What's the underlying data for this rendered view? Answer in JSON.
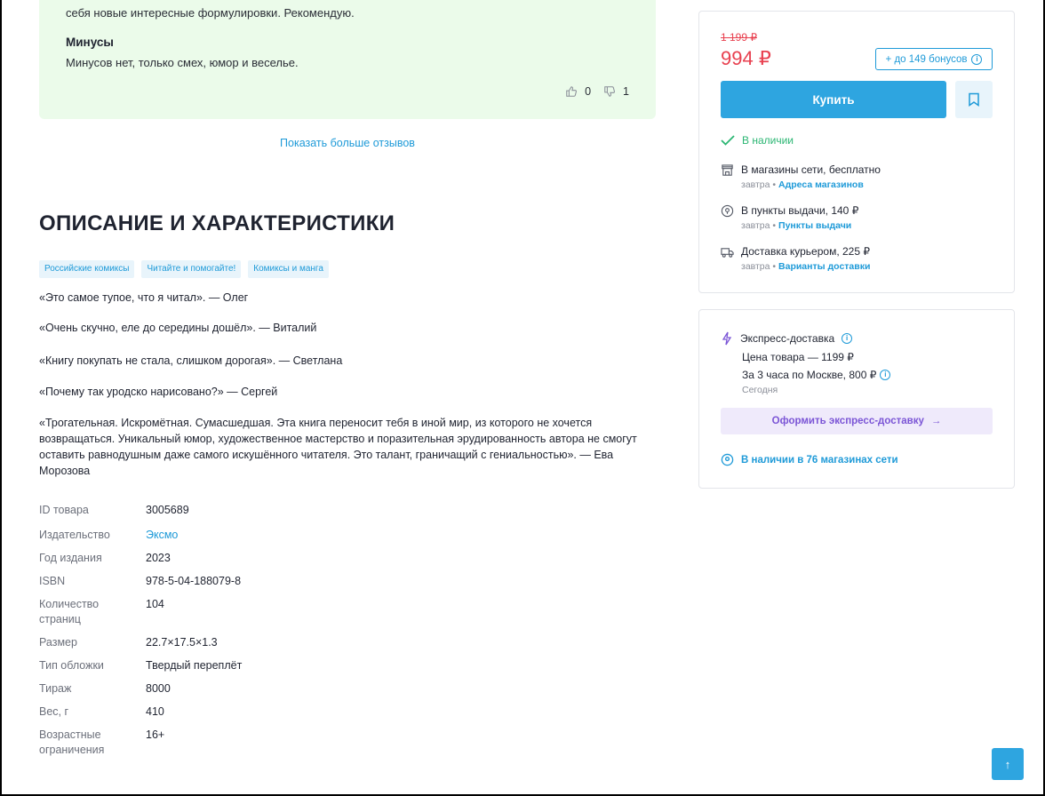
{
  "review": {
    "text_line": "себя новые интересные формулировки. Рекомендую.",
    "minus_heading": "Минусы",
    "minus_text": "Минусов нет, только смех, юмор и веселье.",
    "likes": "0",
    "dislikes": "1"
  },
  "show_more_reviews": "Показать больше отзывов",
  "section_title": "ОПИСАНИЕ И ХАРАКТЕРИСТИКИ",
  "tags": [
    "Российские комиксы",
    "Читайте и помогайте!",
    "Комиксы и манга"
  ],
  "description": [
    "«Это самое тупое, что я читал». — Олег",
    "«Очень скучно, еле до середины дошёл». — Виталий",
    "«Книгу покупать не стала, слишком дорогая». — Светлана",
    "«Почему так уродско нарисовано?» — Сергей",
    "«Трогательная. Искромётная. Сумасшедшая. Эта книга переносит тебя в иной мир, из которого не хочется возвращаться. Уникальный юмор, художественное мастерство и поразительная эрудированность автора не смогут оставить равнодушным даже самого искушённого читателя. Это талант, граничащий с гениальностью». — Ева Морозова"
  ],
  "specs": [
    {
      "key": "ID товара",
      "value": "3005689"
    },
    {
      "key": "Издательство",
      "value": "Эксмо"
    },
    {
      "key": "Год издания",
      "value": "2023"
    },
    {
      "key": "ISBN",
      "value": "978-5-04-188079-8"
    },
    {
      "key": "Количество страниц",
      "value": "104"
    },
    {
      "key": "Размер",
      "value": "22.7×17.5×1.3"
    },
    {
      "key": "Тип обложки",
      "value": "Твердый переплёт"
    },
    {
      "key": "Тираж",
      "value": "8000"
    },
    {
      "key": "Вес, г",
      "value": "410"
    },
    {
      "key": "Возрастные ограничения",
      "value": "16+"
    }
  ],
  "buy": {
    "old_price": "1 199 ₽",
    "price": "994 ₽",
    "bonus": "+ до 149 бонусов",
    "buy_label": "Купить",
    "in_stock": "В наличии",
    "delivery": [
      {
        "title": "В магазины сети, бесплатно",
        "when": "завтра",
        "link": "Адреса магазинов",
        "icon": "store-icon"
      },
      {
        "title": "В пункты выдачи, 140 ₽",
        "when": "завтра",
        "link": "Пункты выдачи",
        "icon": "pin-icon"
      },
      {
        "title": "Доставка курьером, 225 ₽",
        "when": "завтра",
        "link": "Варианты доставки",
        "icon": "truck-icon"
      }
    ]
  },
  "express": {
    "title": "Экспресс-доставка",
    "item_price": "Цена товара — 1199 ₽",
    "moscow": "За 3 часа по Москве, 800 ₽",
    "today": "Сегодня",
    "button": "Оформить экспресс-доставку",
    "stores": "В наличии в 76 магазинах сети"
  },
  "colors": {
    "accent": "#2ea5e0",
    "price": "#e8404f",
    "success": "#2bb673",
    "express": "#7b55d6"
  }
}
